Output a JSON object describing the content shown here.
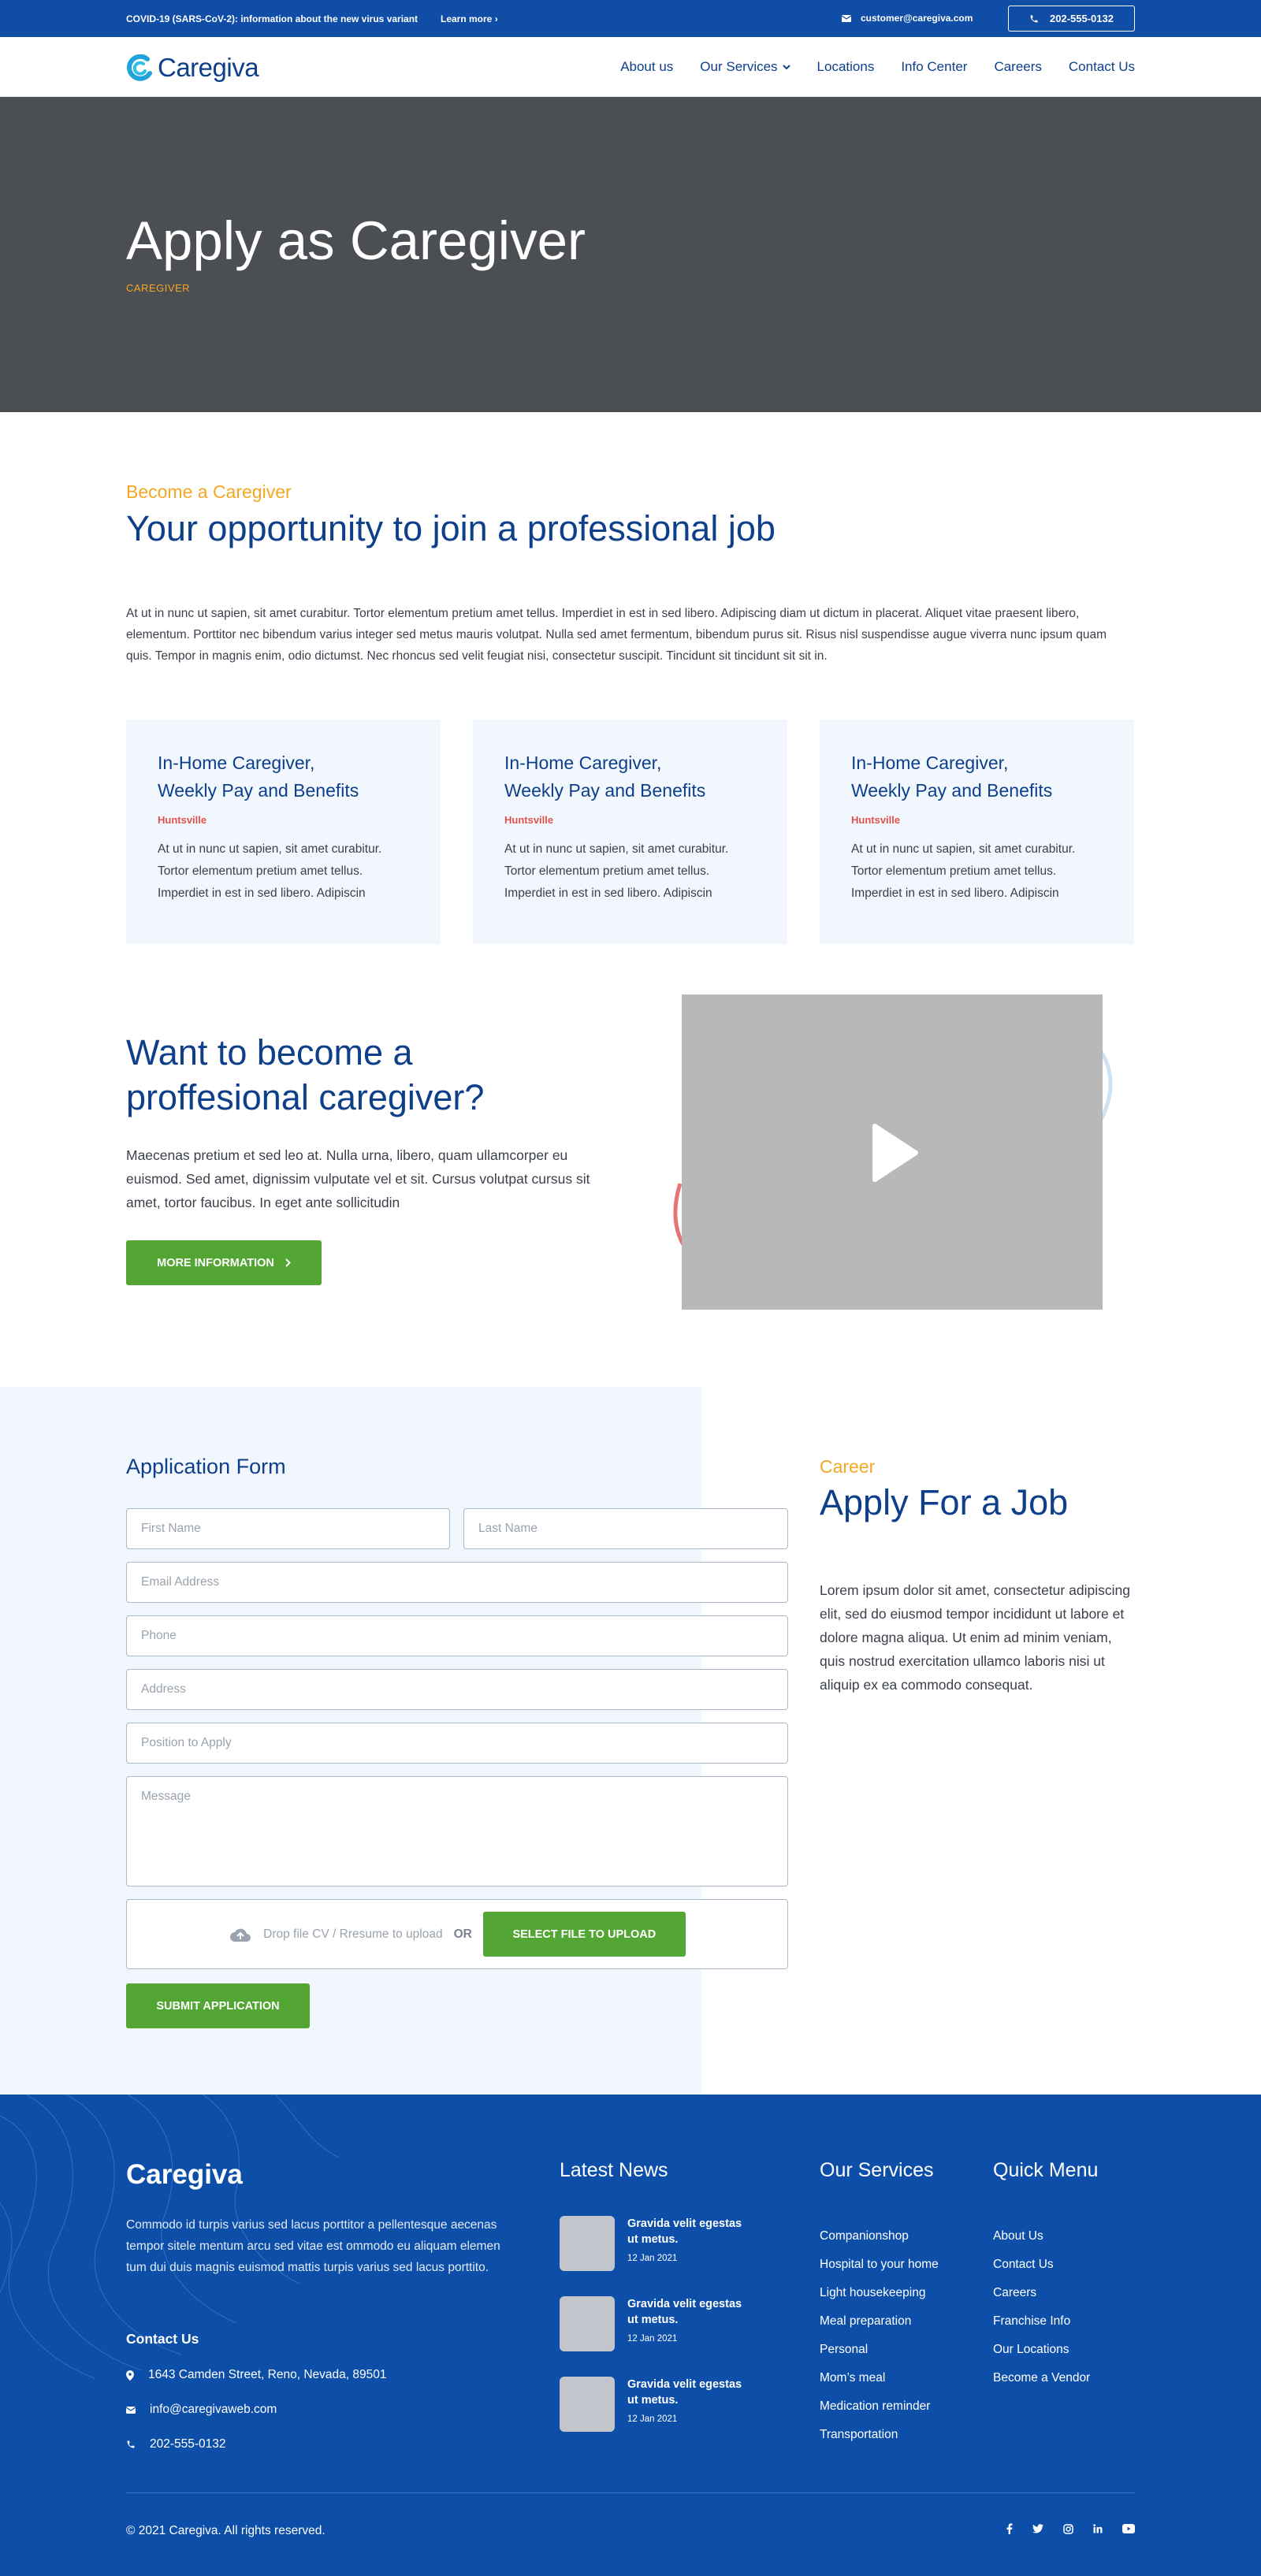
{
  "topbar": {
    "alert": "COVID-19 (SARS-CoV-2): information about the new virus variant",
    "learn_more": "Learn more",
    "email": "customer@caregiva.com",
    "phone": "202-555-0132"
  },
  "nav": {
    "logo": "Caregiva",
    "items": [
      "About us",
      "Our Services",
      "Locations",
      "Info Center",
      "Careers",
      "Contact Us"
    ]
  },
  "hero": {
    "title": "Apply as Caregiver",
    "breadcrumb": "CAREGIVER"
  },
  "intro": {
    "eyebrow": "Become a Caregiver",
    "title": "Your opportunity to join a professional job",
    "paragraph": "At ut in nunc ut sapien, sit amet curabitur. Tortor elementum pretium amet tellus. Imperdiet in est in sed libero. Adipiscing diam ut dictum in placerat. Aliquet vitae praesent libero, elementum. Porttitor nec bibendum varius integer sed metus mauris volutpat. Nulla sed amet fermentum, bibendum purus sit. Risus nisl suspendisse augue viverra nunc ipsum quam quis. Tempor in magnis enim, odio dictumst. Nec rhoncus sed velit feugiat nisi, consectetur suscipit. Tincidunt sit tincidunt sit sit in."
  },
  "cards": [
    {
      "title_line1": "In-Home Caregiver,",
      "title_line2": "Weekly Pay and Benefits",
      "location": "Huntsville",
      "text": "At ut in nunc ut sapien, sit amet curabitur. Tortor elementum pretium amet tellus. Imperdiet in est in sed libero. Adipiscin"
    },
    {
      "title_line1": "In-Home Caregiver,",
      "title_line2": "Weekly Pay and Benefits",
      "location": "Huntsville",
      "text": "At ut in nunc ut sapien, sit amet curabitur. Tortor elementum pretium amet tellus. Imperdiet in est in sed libero. Adipiscin"
    },
    {
      "title_line1": "In-Home Caregiver,",
      "title_line2": "Weekly Pay and Benefits",
      "location": "Huntsville",
      "text": "At ut in nunc ut sapien, sit amet curabitur. Tortor elementum pretium amet tellus. Imperdiet in est in sed libero. Adipiscin"
    }
  ],
  "become": {
    "title_line1": "Want to become a",
    "title_line2": "proffesional caregiver?",
    "paragraph": "Maecenas pretium et sed leo at. Nulla urna, libero, quam ullamcorper eu euismod. Sed amet, dignissim vulputate vel et sit. Cursus volutpat cursus sit amet, tortor faucibus. In eget ante sollicitudin",
    "button": "MORE INFORMATION"
  },
  "form": {
    "title": "Application Form",
    "first_name": "First Name",
    "last_name": "Last Name",
    "email": "Email Address",
    "phone": "Phone",
    "address": "Address",
    "position": "Position to Apply",
    "message": "Message",
    "drop_text": "Drop file CV / Rresume to upload",
    "or": "OR",
    "select_button": "SELECT FILE TO UPLOAD",
    "submit": "SUBMIT APPLICATION"
  },
  "career": {
    "eyebrow": "Career",
    "title": "Apply For a Job",
    "paragraph": "Lorem ipsum dolor sit amet, consectetur adipiscing elit, sed do eiusmod tempor incididunt ut labore et dolore magna aliqua. Ut enim ad minim veniam, quis nostrud exercitation ullamco laboris nisi ut aliquip ex ea commodo consequat."
  },
  "footer": {
    "logo": "Caregiva",
    "description": "Commodo id turpis varius sed lacus porttitor a pellentesque aecenas tempor sitele mentum arcu sed vitae est ommodo eu aliquam elemen tum dui duis magnis euismod mattis turpis varius sed lacus porttito.",
    "contact_heading": "Contact Us",
    "address": "1643  Camden Street, Reno, Nevada, 89501",
    "email": "info@caregivaweb.com",
    "phone": "202-555-0132",
    "news_heading": "Latest News",
    "news": [
      {
        "title": "Gravida velit egestas ut metus.",
        "date": "12 Jan 2021"
      },
      {
        "title": "Gravida velit egestas ut metus.",
        "date": "12 Jan 2021"
      },
      {
        "title": "Gravida velit egestas ut metus.",
        "date": "12 Jan 2021"
      }
    ],
    "services_heading": "Our Services",
    "services": [
      "Companionshop",
      "Hospital to your home",
      "Light housekeeping",
      "Meal preparation",
      "Personal",
      "Mom’s meal",
      "Medication reminder",
      "Transportation"
    ],
    "quick_heading": "Quick Menu",
    "quick": [
      "About Us",
      "Contact Us",
      "Careers",
      "Franchise Info",
      "Our Locations",
      "Become a Vendor"
    ],
    "copyright": "© 2021 Caregiva. All rights reserved.",
    "social": [
      "facebook-icon",
      "twitter-icon",
      "instagram-icon",
      "linkedin-icon",
      "youtube-icon"
    ]
  },
  "colors": {
    "primary_blue": "#0f4da6",
    "heading_blue": "#0d3f8a",
    "accent_orange": "#f6a623",
    "accent_red": "#e0524f",
    "button_green": "#53a633",
    "hero_gray": "#4b4e52",
    "light_bg": "#f2f7fd"
  }
}
